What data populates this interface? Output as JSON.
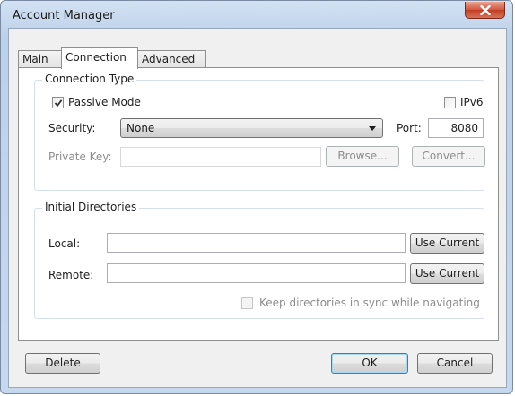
{
  "window": {
    "title": "Account Manager"
  },
  "tabs": [
    {
      "label": "Main"
    },
    {
      "label": "Connection"
    },
    {
      "label": "Advanced"
    }
  ],
  "connection_type": {
    "title": "Connection Type",
    "passive_mode_label": "Passive Mode",
    "passive_mode_checked": true,
    "ipv6_label": "IPv6",
    "ipv6_checked": false,
    "security_label": "Security:",
    "security_value": "None",
    "port_label": "Port:",
    "port_value": "8080",
    "private_key_label": "Private Key:",
    "private_key_value": "",
    "browse_label": "Browse...",
    "convert_label": "Convert..."
  },
  "initial_directories": {
    "title": "Initial Directories",
    "local_label": "Local:",
    "local_value": "",
    "remote_label": "Remote:",
    "remote_value": "",
    "use_current_label": "Use Current",
    "sync_label": "Keep directories in sync while navigating",
    "sync_checked": false
  },
  "footer": {
    "delete_label": "Delete",
    "ok_label": "OK",
    "cancel_label": "Cancel"
  },
  "colors": {
    "frame": "#c4d6ec",
    "close_button": "#c13d22",
    "client_bg": "#f0f0f0",
    "default_button_border": "#3c7fb1"
  }
}
